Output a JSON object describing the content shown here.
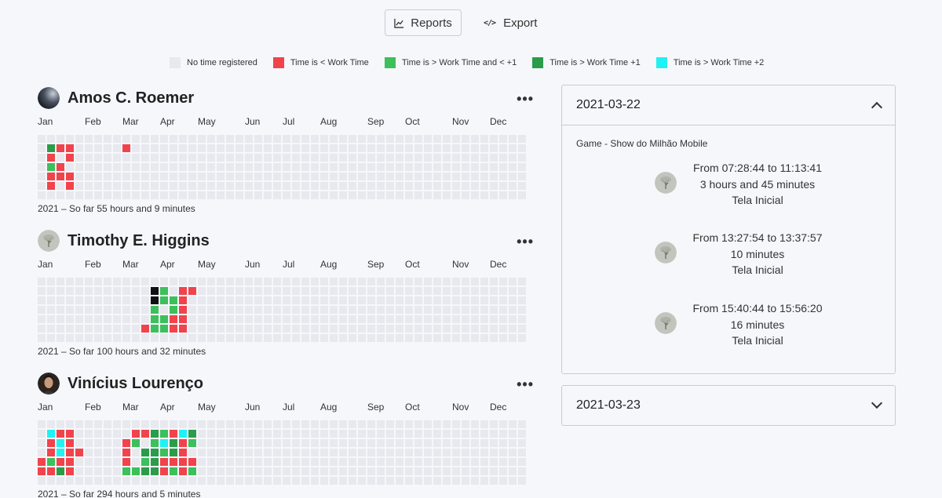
{
  "toolbar": {
    "reports_label": "Reports",
    "export_label": "Export"
  },
  "legend": [
    {
      "label": "No time registered",
      "color": "#e8e9ee"
    },
    {
      "label": "Time is < Work Time",
      "color": "#f1434c"
    },
    {
      "label": "Time is > Work Time and < +1",
      "color": "#3cc05b"
    },
    {
      "label": "Time is > Work Time +1",
      "color": "#2a9c4a"
    },
    {
      "label": "Time is > Work Time +2",
      "color": "#1ff2f2"
    }
  ],
  "colors": {
    "empty": "#e8e9ee",
    "red": "#f1434c",
    "green": "#3cc05b",
    "dark": "#2a9c4a",
    "cyan": "#1ff2f2",
    "black": "#111111"
  },
  "months": [
    "Jan",
    "Feb",
    "Mar",
    "Apr",
    "May",
    "Jun",
    "Jul",
    "Aug",
    "Sep",
    "Oct",
    "Nov",
    "Dec"
  ],
  "users": [
    {
      "name": "Amos C. Roemer",
      "summary": "2021 – So far 55 hours and 9 minutes",
      "avatar_icon": "dark-avatar-icon",
      "days": [
        {
          "w": 1,
          "d": 1,
          "c": "dark"
        },
        {
          "w": 2,
          "d": 1,
          "c": "red"
        },
        {
          "w": 3,
          "d": 1,
          "c": "red"
        },
        {
          "w": 1,
          "d": 2,
          "c": "red"
        },
        {
          "w": 3,
          "d": 2,
          "c": "red"
        },
        {
          "w": 1,
          "d": 3,
          "c": "green"
        },
        {
          "w": 2,
          "d": 3,
          "c": "red"
        },
        {
          "w": 1,
          "d": 4,
          "c": "red"
        },
        {
          "w": 2,
          "d": 4,
          "c": "red"
        },
        {
          "w": 3,
          "d": 4,
          "c": "red"
        },
        {
          "w": 1,
          "d": 5,
          "c": "red"
        },
        {
          "w": 3,
          "d": 5,
          "c": "red"
        },
        {
          "w": 9,
          "d": 1,
          "c": "red"
        }
      ]
    },
    {
      "name": "Timothy E. Higgins",
      "summary": "2021 – So far 100 hours and 32 minutes",
      "avatar_icon": "tree-avatar-icon",
      "days": [
        {
          "w": 12,
          "d": 1,
          "c": "black"
        },
        {
          "w": 13,
          "d": 1,
          "c": "green"
        },
        {
          "w": 15,
          "d": 1,
          "c": "red"
        },
        {
          "w": 16,
          "d": 1,
          "c": "red"
        },
        {
          "w": 12,
          "d": 2,
          "c": "black"
        },
        {
          "w": 13,
          "d": 2,
          "c": "green"
        },
        {
          "w": 14,
          "d": 2,
          "c": "green"
        },
        {
          "w": 15,
          "d": 2,
          "c": "red"
        },
        {
          "w": 12,
          "d": 3,
          "c": "green"
        },
        {
          "w": 14,
          "d": 3,
          "c": "green"
        },
        {
          "w": 15,
          "d": 3,
          "c": "red"
        },
        {
          "w": 12,
          "d": 4,
          "c": "green"
        },
        {
          "w": 13,
          "d": 4,
          "c": "green"
        },
        {
          "w": 14,
          "d": 4,
          "c": "red"
        },
        {
          "w": 15,
          "d": 4,
          "c": "red"
        },
        {
          "w": 11,
          "d": 5,
          "c": "red"
        },
        {
          "w": 12,
          "d": 5,
          "c": "green"
        },
        {
          "w": 13,
          "d": 5,
          "c": "green"
        },
        {
          "w": 14,
          "d": 5,
          "c": "red"
        },
        {
          "w": 15,
          "d": 5,
          "c": "red"
        }
      ]
    },
    {
      "name": "Vinícius Lourenço",
      "summary": "2021 – So far 294 hours and 5 minutes",
      "avatar_icon": "portrait-avatar-icon",
      "days": [
        {
          "w": 1,
          "d": 1,
          "c": "cyan"
        },
        {
          "w": 2,
          "d": 1,
          "c": "red"
        },
        {
          "w": 3,
          "d": 1,
          "c": "red"
        },
        {
          "w": 10,
          "d": 1,
          "c": "red"
        },
        {
          "w": 11,
          "d": 1,
          "c": "red"
        },
        {
          "w": 12,
          "d": 1,
          "c": "dark"
        },
        {
          "w": 13,
          "d": 1,
          "c": "green"
        },
        {
          "w": 14,
          "d": 1,
          "c": "red"
        },
        {
          "w": 15,
          "d": 1,
          "c": "cyan"
        },
        {
          "w": 16,
          "d": 1,
          "c": "dark"
        },
        {
          "w": 1,
          "d": 2,
          "c": "red"
        },
        {
          "w": 2,
          "d": 2,
          "c": "cyan"
        },
        {
          "w": 3,
          "d": 2,
          "c": "red"
        },
        {
          "w": 9,
          "d": 2,
          "c": "red"
        },
        {
          "w": 10,
          "d": 2,
          "c": "green"
        },
        {
          "w": 12,
          "d": 2,
          "c": "green"
        },
        {
          "w": 13,
          "d": 2,
          "c": "cyan"
        },
        {
          "w": 14,
          "d": 2,
          "c": "dark"
        },
        {
          "w": 15,
          "d": 2,
          "c": "red"
        },
        {
          "w": 16,
          "d": 2,
          "c": "green"
        },
        {
          "w": 1,
          "d": 3,
          "c": "red"
        },
        {
          "w": 2,
          "d": 3,
          "c": "cyan"
        },
        {
          "w": 3,
          "d": 3,
          "c": "red"
        },
        {
          "w": 4,
          "d": 3,
          "c": "red"
        },
        {
          "w": 9,
          "d": 3,
          "c": "red"
        },
        {
          "w": 11,
          "d": 3,
          "c": "dark"
        },
        {
          "w": 12,
          "d": 3,
          "c": "dark"
        },
        {
          "w": 13,
          "d": 3,
          "c": "green"
        },
        {
          "w": 14,
          "d": 3,
          "c": "dark"
        },
        {
          "w": 15,
          "d": 3,
          "c": "red"
        },
        {
          "w": 0,
          "d": 4,
          "c": "red"
        },
        {
          "w": 1,
          "d": 4,
          "c": "green"
        },
        {
          "w": 2,
          "d": 4,
          "c": "red"
        },
        {
          "w": 3,
          "d": 4,
          "c": "red"
        },
        {
          "w": 9,
          "d": 4,
          "c": "red"
        },
        {
          "w": 11,
          "d": 4,
          "c": "green"
        },
        {
          "w": 12,
          "d": 4,
          "c": "dark"
        },
        {
          "w": 13,
          "d": 4,
          "c": "red"
        },
        {
          "w": 14,
          "d": 4,
          "c": "red"
        },
        {
          "w": 15,
          "d": 4,
          "c": "red"
        },
        {
          "w": 16,
          "d": 4,
          "c": "red"
        },
        {
          "w": 0,
          "d": 5,
          "c": "red"
        },
        {
          "w": 1,
          "d": 5,
          "c": "red"
        },
        {
          "w": 2,
          "d": 5,
          "c": "dark"
        },
        {
          "w": 3,
          "d": 5,
          "c": "red"
        },
        {
          "w": 9,
          "d": 5,
          "c": "green"
        },
        {
          "w": 10,
          "d": 5,
          "c": "green"
        },
        {
          "w": 11,
          "d": 5,
          "c": "dark"
        },
        {
          "w": 12,
          "d": 5,
          "c": "dark"
        },
        {
          "w": 13,
          "d": 5,
          "c": "red"
        },
        {
          "w": 14,
          "d": 5,
          "c": "green"
        },
        {
          "w": 15,
          "d": 5,
          "c": "red"
        },
        {
          "w": 16,
          "d": 5,
          "c": "green"
        }
      ]
    }
  ],
  "panels": [
    {
      "date": "2021-03-22",
      "expanded": true,
      "project": "Game - Show do Milhão Mobile",
      "entries": [
        {
          "range": "From 07:28:44 to 11:13:41",
          "duration": "3 hours and 45 minutes",
          "screen": "Tela Inicial",
          "avatar_icon": "tree-avatar-icon"
        },
        {
          "range": "From 13:27:54 to 13:37:57",
          "duration": "10 minutes",
          "screen": "Tela Inicial",
          "avatar_icon": "tree-avatar-icon"
        },
        {
          "range": "From 15:40:44 to 15:56:20",
          "duration": "16 minutes",
          "screen": "Tela Inicial",
          "avatar_icon": "tree-avatar-icon"
        }
      ]
    },
    {
      "date": "2021-03-23",
      "expanded": false
    }
  ]
}
